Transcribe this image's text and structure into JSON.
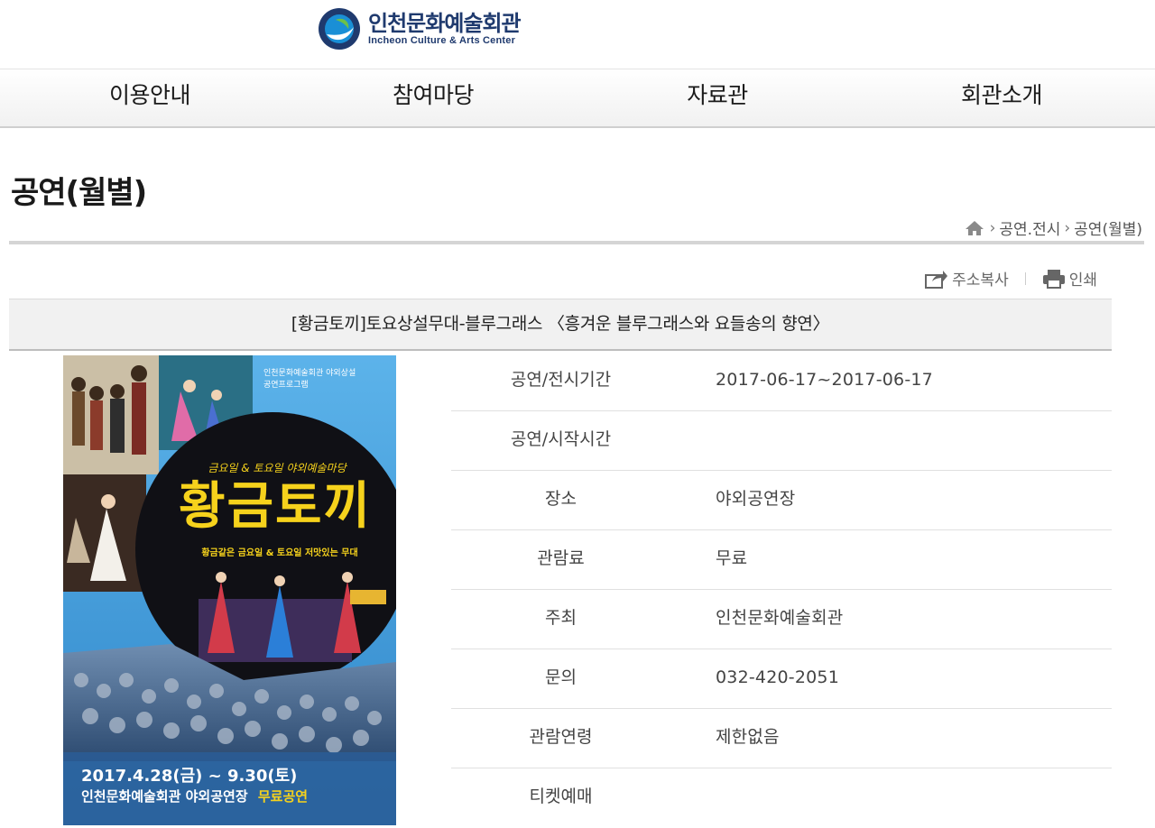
{
  "header": {
    "logo_ko": "인천문화예술회관",
    "logo_en": "Incheon Culture & Arts Center"
  },
  "nav": {
    "items": [
      {
        "label": "이용안내"
      },
      {
        "label": "참여마당"
      },
      {
        "label": "자료관"
      },
      {
        "label": "회관소개"
      }
    ]
  },
  "page": {
    "title": "공연(월별)"
  },
  "breadcrumb": {
    "home_icon": "home-icon",
    "items": [
      "공연.전시",
      "공연(월별)"
    ]
  },
  "utility": {
    "copy_address": "주소복사",
    "print": "인쇄"
  },
  "event": {
    "title": "[황금토끼]토요상설무대-블루그래스 〈흥겨운 블루그래스와 요들송의 향연〉"
  },
  "poster": {
    "top_text_1": "인천문화예술회관 야외상설",
    "top_text_2": "공연프로그램",
    "subtitle": "금요일 & 토요일 야외예술마당",
    "headline": "황금토끼",
    "tagline": "황금같은 금요일 & 토요일 저맛있는 무대",
    "date_line": "2017.4.28(금) ~ 9.30(토)",
    "venue_line": "인천문화예술회관 야외공연장",
    "free_label": "무료공연"
  },
  "info": {
    "rows": [
      {
        "label": "공연/전시기간",
        "value": "2017-06-17~2017-06-17"
      },
      {
        "label": "공연/시작시간",
        "value": ""
      },
      {
        "label": "장소",
        "value": "야외공연장"
      },
      {
        "label": "관람료",
        "value": "무료"
      },
      {
        "label": "주최",
        "value": "인천문화예술회관"
      },
      {
        "label": "문의",
        "value": "032-420-2051"
      },
      {
        "label": "관람연령",
        "value": "제한없음"
      },
      {
        "label": "티켓예매",
        "value": ""
      }
    ]
  },
  "colors": {
    "brand_navy": "#1f3a6e",
    "brand_blue": "#1a8fd6",
    "poster_bg": "#4aa8e3",
    "poster_headline": "#f6d21c"
  }
}
